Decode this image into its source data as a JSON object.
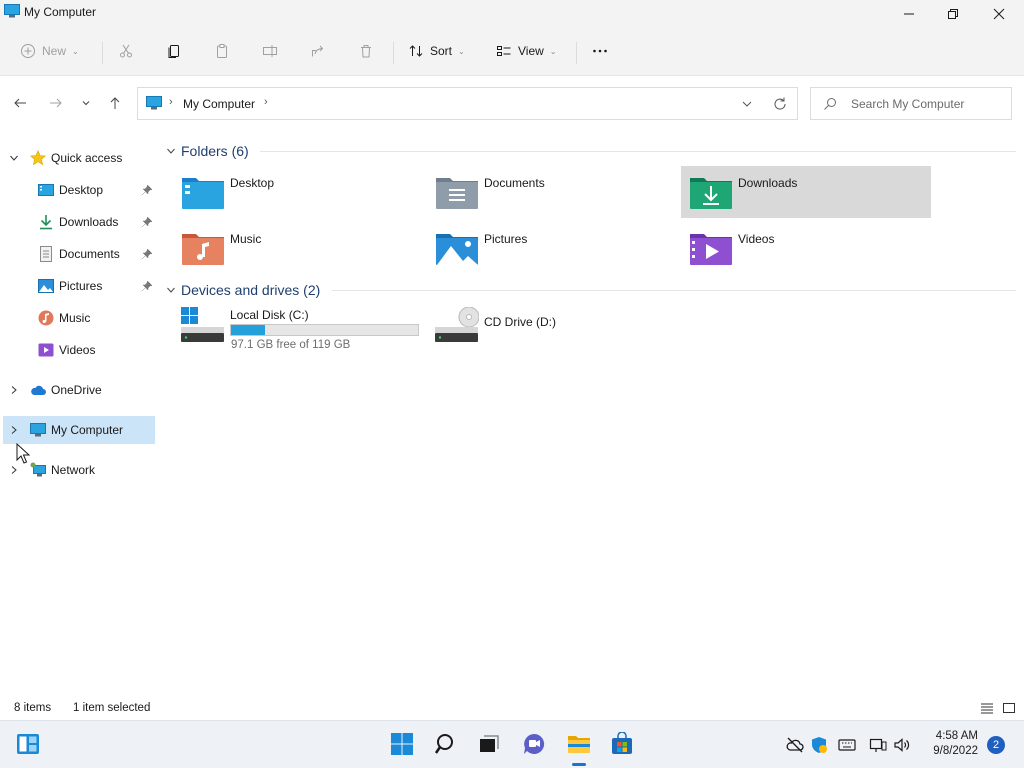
{
  "window": {
    "title": "My Computer"
  },
  "commands": {
    "new_label": "New",
    "sort_label": "Sort",
    "view_label": "View"
  },
  "address": {
    "crumb": "My Computer",
    "search_placeholder": "Search My Computer"
  },
  "nav": {
    "quick_access": "Quick access",
    "items": [
      {
        "label": "Desktop",
        "pinned": true
      },
      {
        "label": "Downloads",
        "pinned": true
      },
      {
        "label": "Documents",
        "pinned": true
      },
      {
        "label": "Pictures",
        "pinned": true
      },
      {
        "label": "Music",
        "pinned": false
      },
      {
        "label": "Videos",
        "pinned": false
      }
    ],
    "onedrive": "OneDrive",
    "my_computer": "My Computer",
    "network": "Network"
  },
  "content": {
    "folders_header": "Folders (6)",
    "folders": [
      {
        "name": "Desktop"
      },
      {
        "name": "Documents"
      },
      {
        "name": "Downloads"
      },
      {
        "name": "Music"
      },
      {
        "name": "Pictures"
      },
      {
        "name": "Videos"
      }
    ],
    "devices_header": "Devices and drives (2)",
    "drives": [
      {
        "name": "Local Disk (C:)",
        "free_text": "97.1 GB free of 119 GB",
        "used_fraction": 0.184
      },
      {
        "name": "CD Drive (D:)"
      }
    ]
  },
  "status": {
    "item_count": "8 items",
    "selection": "1 item selected"
  },
  "taskbar": {
    "time": "4:58 AM",
    "date": "9/8/2022",
    "notification_count": "2"
  },
  "colors": {
    "accent": "#26a0da",
    "selection": "#cce4f7",
    "tile_selected": "#d9d9d9"
  }
}
